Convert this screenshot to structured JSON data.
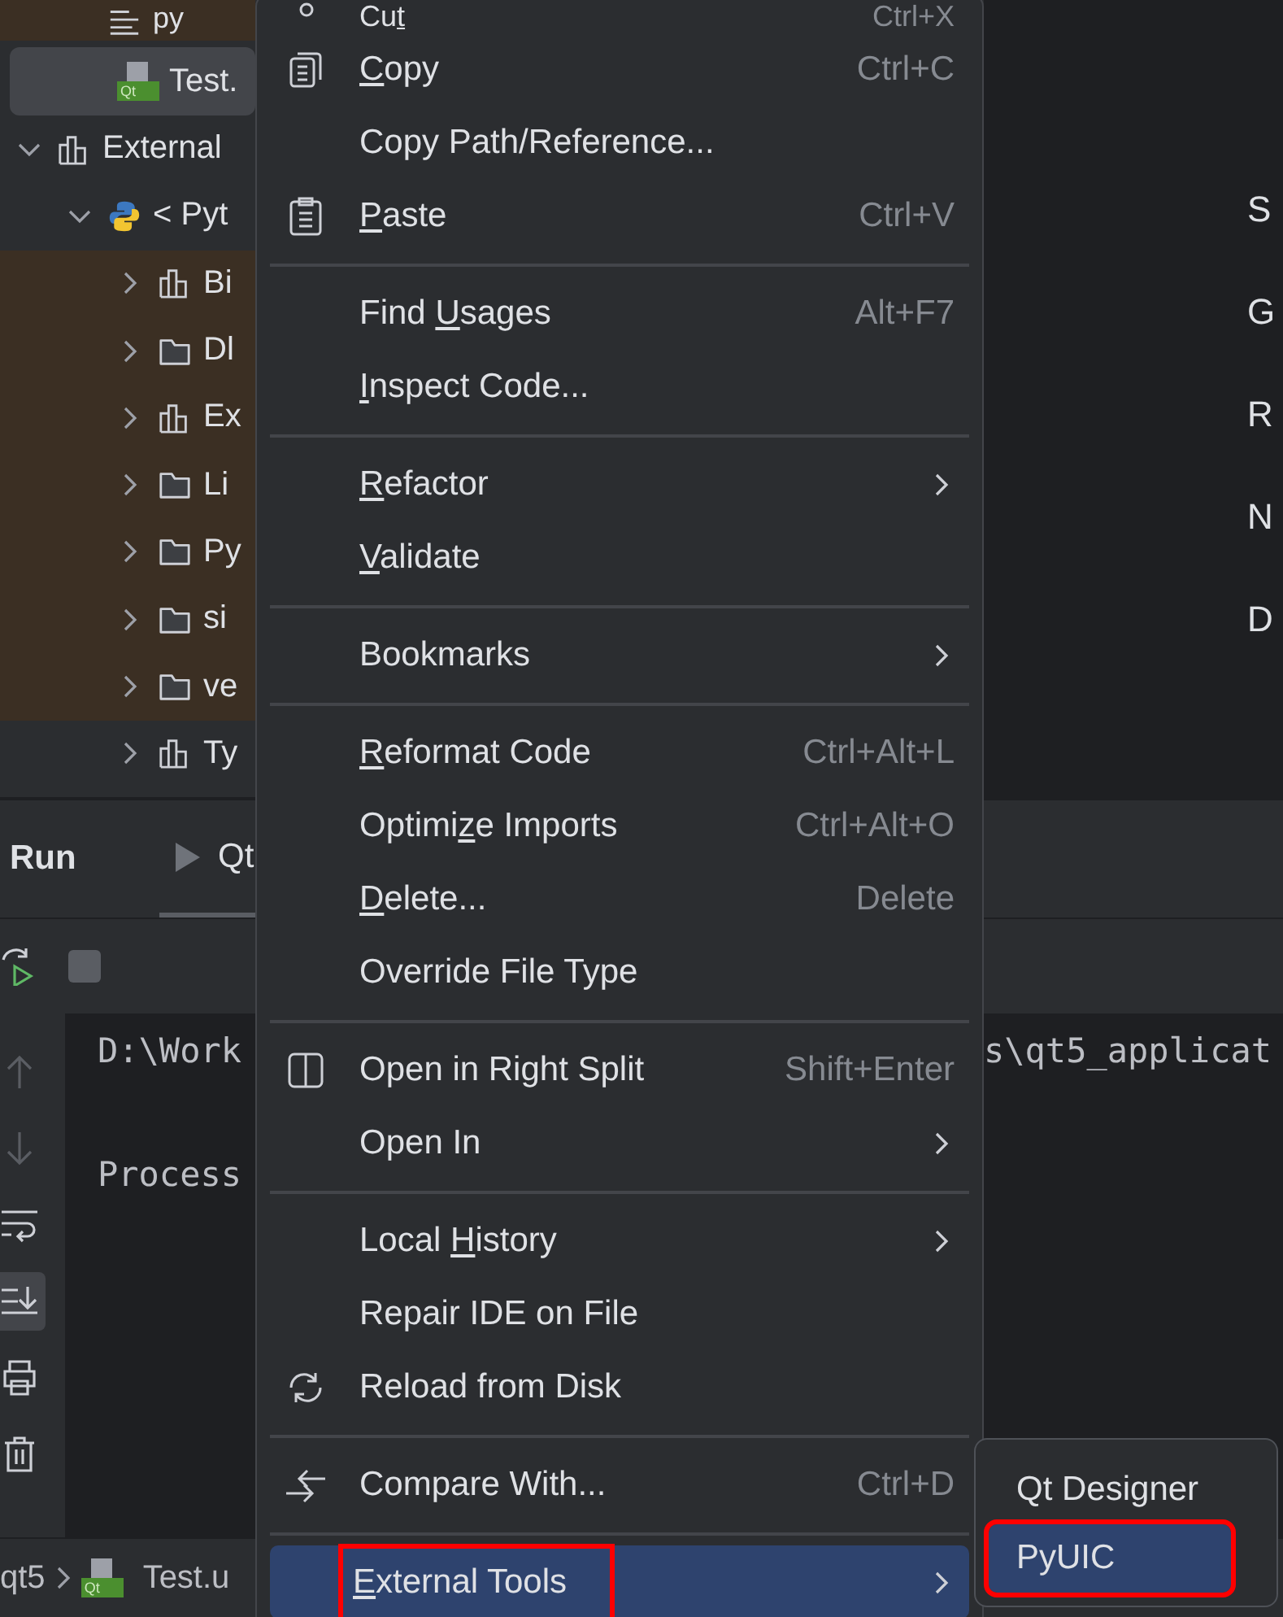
{
  "project_tree": {
    "items": [
      {
        "label": "py",
        "kind": "text-file",
        "color": "#3b2f23"
      },
      {
        "label": "Test.",
        "kind": "qt-file",
        "badge": "Qt",
        "selected": true
      },
      {
        "label": "External",
        "kind": "library",
        "expanded": true,
        "children": [
          {
            "label": "< Pyt",
            "kind": "python",
            "expanded": true,
            "children": [
              {
                "label": "Bi",
                "kind": "library",
                "expanded": false,
                "color": "#3b2f23"
              },
              {
                "label": "Dl",
                "kind": "folder",
                "expanded": false,
                "color": "#3b2f23"
              },
              {
                "label": "Ex",
                "kind": "library",
                "expanded": false,
                "color": "#3b2f23"
              },
              {
                "label": "Li",
                "kind": "folder",
                "expanded": false,
                "color": "#3b2f23"
              },
              {
                "label": "Py",
                "kind": "folder",
                "expanded": false,
                "color": "#3b2f23"
              },
              {
                "label": "si",
                "kind": "folder",
                "expanded": false,
                "color": "#3b2f23"
              },
              {
                "label": "ve",
                "kind": "folder",
                "expanded": false,
                "color": "#3b2f23"
              },
              {
                "label": "Ty",
                "kind": "library",
                "expanded": false
              }
            ]
          }
        ]
      }
    ]
  },
  "editor": {
    "fragments": [
      "S",
      "G",
      "R",
      "N",
      "D"
    ]
  },
  "run_panel": {
    "title": "Run",
    "tabs": [
      {
        "label": "Qt",
        "selected": true
      }
    ],
    "toolbar": [
      {
        "kind": "rerun"
      },
      {
        "kind": "stop"
      }
    ],
    "side_tools": [
      {
        "kind": "up",
        "selected": false,
        "disabled": true
      },
      {
        "kind": "down",
        "selected": false,
        "disabled": true
      },
      {
        "kind": "wrap",
        "selected": false,
        "disabled": false
      },
      {
        "kind": "scroll-end",
        "selected": true,
        "disabled": false
      },
      {
        "kind": "print",
        "selected": false,
        "disabled": false
      },
      {
        "kind": "trash",
        "selected": false,
        "disabled": false
      }
    ],
    "console_lines": [
      {
        "text": "D:\\Work",
        "tail": "s\\qt5_applicat"
      },
      {
        "text": "Process"
      }
    ]
  },
  "status_bar": {
    "breadcrumbs": [
      {
        "label": "qt5"
      },
      {
        "label": "Test.u",
        "badge": "Qt"
      }
    ]
  },
  "context_menu": {
    "items": [
      {
        "kind": "item",
        "selected": false,
        "label": [
          {
            "text": "Cu",
            "underline": false
          },
          {
            "text": "t",
            "underline": true
          }
        ],
        "shortcut": "Ctrl+X"
      },
      {
        "kind": "item",
        "selected": false,
        "label": [
          {
            "text": "C",
            "underline": true
          },
          {
            "text": "opy",
            "underline": false
          }
        ],
        "shortcut": "Ctrl+C"
      },
      {
        "kind": "item",
        "selected": false,
        "label": [
          {
            "text": "Copy Path/Reference...",
            "underline": false
          }
        ]
      },
      {
        "kind": "item",
        "selected": false,
        "label": [
          {
            "text": "P",
            "underline": true
          },
          {
            "text": "aste",
            "underline": false
          }
        ],
        "shortcut": "Ctrl+V"
      },
      {
        "kind": "separator"
      },
      {
        "kind": "item",
        "selected": false,
        "label": [
          {
            "text": "Find ",
            "underline": false
          },
          {
            "text": "U",
            "underline": true
          },
          {
            "text": "sages",
            "underline": false
          }
        ],
        "shortcut": "Alt+F7"
      },
      {
        "kind": "item",
        "selected": false,
        "label": [
          {
            "text": "I",
            "underline": true
          },
          {
            "text": "nspect Code...",
            "underline": false
          }
        ]
      },
      {
        "kind": "separator"
      },
      {
        "kind": "item",
        "selected": false,
        "label": [
          {
            "text": "R",
            "underline": true
          },
          {
            "text": "efactor",
            "underline": false
          }
        ],
        "submenu": true
      },
      {
        "kind": "item",
        "selected": false,
        "label": [
          {
            "text": "V",
            "underline": true
          },
          {
            "text": "alidate",
            "underline": false
          }
        ]
      },
      {
        "kind": "separator"
      },
      {
        "kind": "item",
        "selected": false,
        "label": [
          {
            "text": "Bookmarks",
            "underline": false
          }
        ],
        "submenu": true
      },
      {
        "kind": "separator"
      },
      {
        "kind": "item",
        "selected": false,
        "label": [
          {
            "text": "R",
            "underline": true
          },
          {
            "text": "eformat Code",
            "underline": false
          }
        ],
        "shortcut": "Ctrl+Alt+L"
      },
      {
        "kind": "item",
        "selected": false,
        "label": [
          {
            "text": "Optimi",
            "underline": false
          },
          {
            "text": "z",
            "underline": true
          },
          {
            "text": "e Imports",
            "underline": false
          }
        ],
        "shortcut": "Ctrl+Alt+O"
      },
      {
        "kind": "item",
        "selected": false,
        "label": [
          {
            "text": "D",
            "underline": true
          },
          {
            "text": "elete...",
            "underline": false
          }
        ],
        "shortcut": "Delete"
      },
      {
        "kind": "item",
        "selected": false,
        "label": [
          {
            "text": "Override File Type",
            "underline": false
          }
        ]
      },
      {
        "kind": "separator"
      },
      {
        "kind": "item",
        "selected": false,
        "label": [
          {
            "text": "Open in Right Split",
            "underline": false
          }
        ],
        "shortcut": "Shift+Enter"
      },
      {
        "kind": "item",
        "selected": false,
        "label": [
          {
            "text": "Open In",
            "underline": false
          }
        ],
        "submenu": true
      },
      {
        "kind": "separator"
      },
      {
        "kind": "item",
        "selected": false,
        "label": [
          {
            "text": "Local ",
            "underline": false
          },
          {
            "text": "H",
            "underline": true
          },
          {
            "text": "istory",
            "underline": false
          }
        ],
        "submenu": true
      },
      {
        "kind": "item",
        "selected": false,
        "label": [
          {
            "text": "Repair IDE on File",
            "underline": false
          }
        ]
      },
      {
        "kind": "item",
        "selected": false,
        "label": [
          {
            "text": "Reload from Disk",
            "underline": false
          }
        ]
      },
      {
        "kind": "separator"
      },
      {
        "kind": "item",
        "selected": false,
        "label": [
          {
            "text": "Compare With...",
            "underline": false
          }
        ],
        "shortcut": "Ctrl+D"
      },
      {
        "kind": "separator"
      },
      {
        "kind": "item",
        "selected": true,
        "annotated": true,
        "label": [
          {
            "text": "E",
            "underline": true
          },
          {
            "text": "xternal Tools",
            "underline": false
          }
        ],
        "submenu": true
      }
    ]
  },
  "submenu": {
    "items": [
      {
        "label": "Qt Designer",
        "selected": false,
        "annotated": false
      },
      {
        "label": "PyUIC",
        "selected": true,
        "annotated": true
      }
    ]
  }
}
